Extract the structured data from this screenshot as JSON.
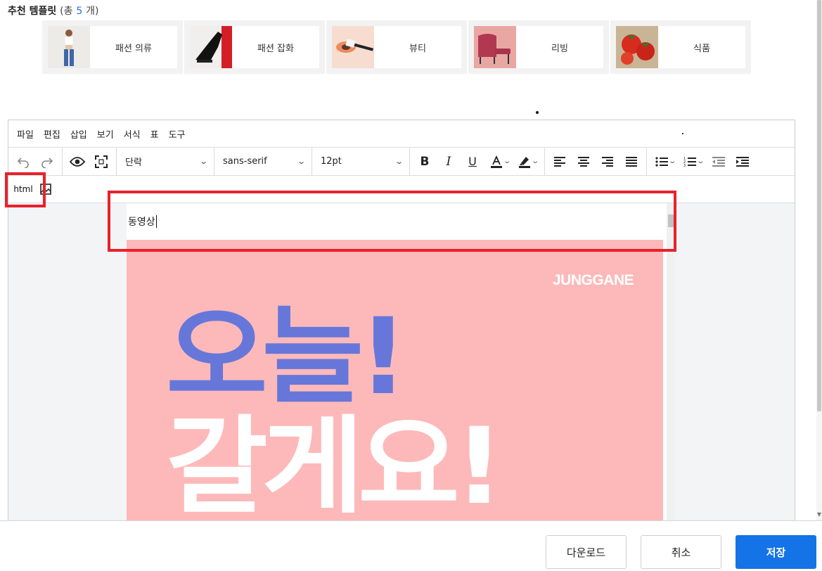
{
  "recommended": {
    "title": "추천 템플릿",
    "count_prefix": "(총",
    "count": "5",
    "count_suffix": "개)",
    "templates": [
      {
        "label": "패션 의류",
        "icon": "fashion-clothing-thumb"
      },
      {
        "label": "패션 잡화",
        "icon": "fashion-goods-thumb"
      },
      {
        "label": "뷰티",
        "icon": "beauty-thumb"
      },
      {
        "label": "리빙",
        "icon": "living-thumb"
      },
      {
        "label": "식품",
        "icon": "food-thumb"
      }
    ]
  },
  "editor": {
    "menu": [
      "파일",
      "편집",
      "삽입",
      "보기",
      "서식",
      "표",
      "도구"
    ],
    "toolbar": {
      "block_format": "단락",
      "font_family": "sans-serif",
      "font_size": "12pt"
    },
    "html_button": "html",
    "content": {
      "first_line": "동영상",
      "brand": "JUNGGANE",
      "headline_line1": "오늘!",
      "headline_line2": "갈게요!"
    }
  },
  "footer": {
    "download": "다운로드",
    "cancel": "취소",
    "save": "저장"
  },
  "colors": {
    "accent": "#1473e6",
    "highlight": "#e8212b",
    "banner_bg": "#fdb9b9",
    "headline_blue": "#6677d9"
  }
}
